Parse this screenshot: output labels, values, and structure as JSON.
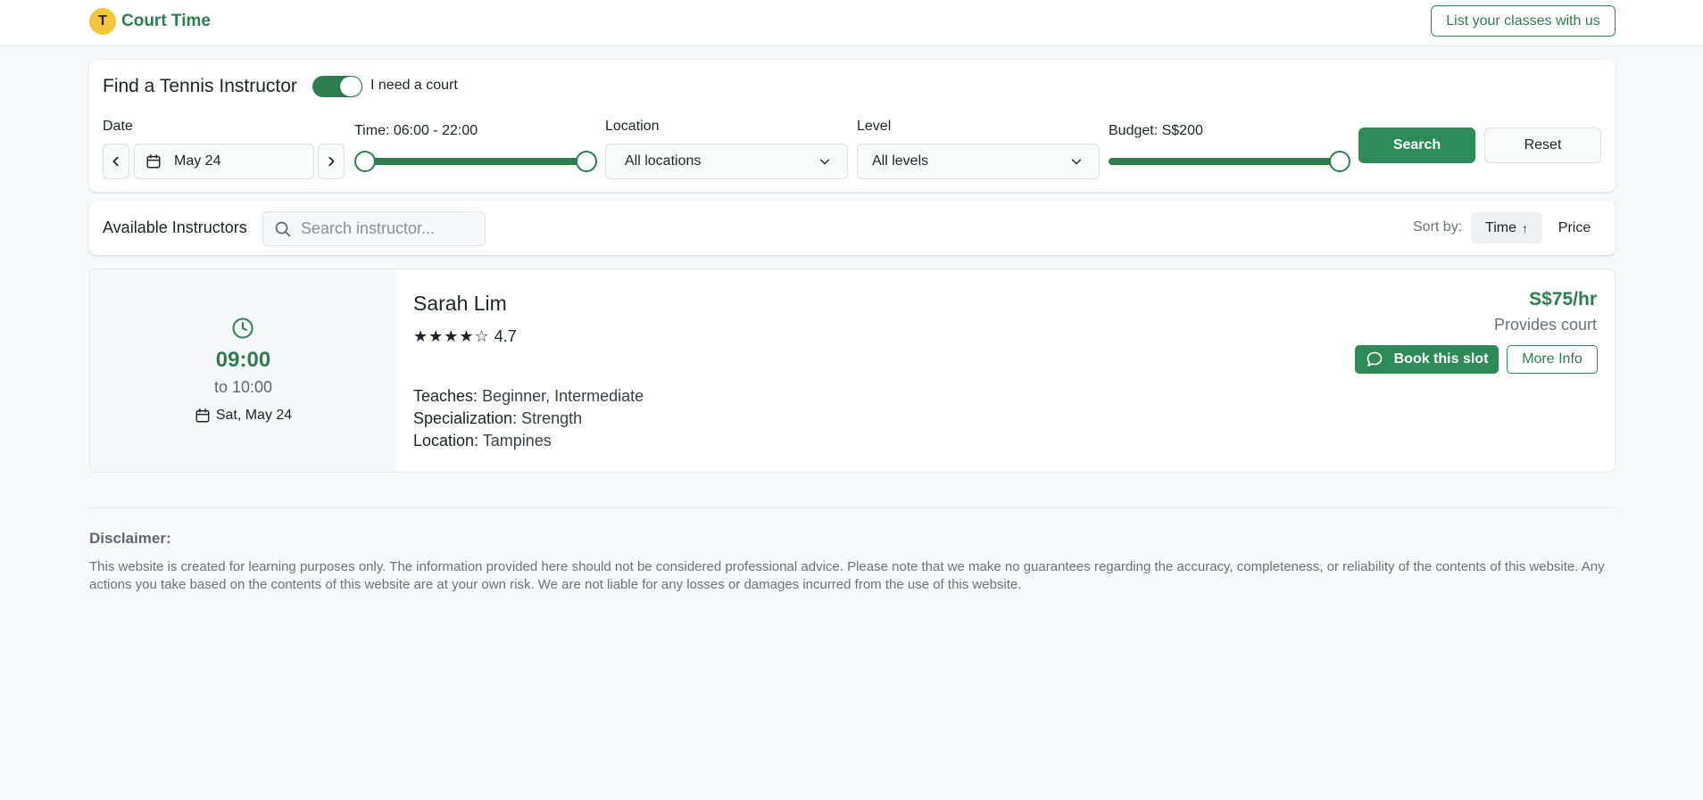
{
  "app": {
    "logo_letter": "T",
    "brand_name": "Court Time",
    "list_classes_label": "List your classes with us"
  },
  "filters": {
    "title": "Find a Tennis Instructor",
    "court_toggle": {
      "label": "I need a court",
      "on": true
    },
    "date": {
      "label": "Date",
      "value": "May 24"
    },
    "time": {
      "label": "Time: 06:00 - 22:00",
      "min": "06:00",
      "max": "22:00"
    },
    "location": {
      "label": "Location",
      "value": "All locations"
    },
    "level": {
      "label": "Level",
      "value": "All levels"
    },
    "budget": {
      "label": "Budget: S$200",
      "value": 200
    },
    "search_label": "Search",
    "reset_label": "Reset"
  },
  "list": {
    "title": "Available Instructors",
    "search_placeholder": "Search instructor...",
    "sort_label": "Sort by:",
    "sort_time": "Time",
    "sort_time_arrow": "↑",
    "sort_price": "Price"
  },
  "slots": [
    {
      "start": "09:00",
      "end": "to 10:00",
      "date": "Sat, May 24",
      "name": "Sarah Lim",
      "stars": "★★★★☆",
      "rating": "4.7",
      "teaches_label": "Teaches:",
      "teaches": "Beginner, Intermediate",
      "specialization_label": "Specialization:",
      "specialization": "Strength",
      "location_label": "Location:",
      "location": "Tampines",
      "price": "S$75/hr",
      "court": "Provides court",
      "book_label": "Book this slot",
      "more_label": "More Info"
    }
  ],
  "disclaimer": {
    "title": "Disclaimer:",
    "text": "This website is created for learning purposes only. The information provided here should not be considered professional advice. Please note that we make no guarantees regarding the accuracy, completeness, or reliability of the contents of this website. Any actions you take based on the contents of this website are at your own risk. We are not liable for any losses or damages incurred from the use of this website."
  },
  "colors": {
    "accent": "#2e8b57",
    "brand_text": "#2e7d4f",
    "logo_bg": "#f5c53d",
    "page_bg": "#f8f9fa"
  },
  "icons": [
    "calendar-icon",
    "chevron-left-icon",
    "chevron-right-icon",
    "chevron-down-icon",
    "search-icon",
    "clock-icon",
    "chat-bubble-icon",
    "arrow-up-icon"
  ]
}
